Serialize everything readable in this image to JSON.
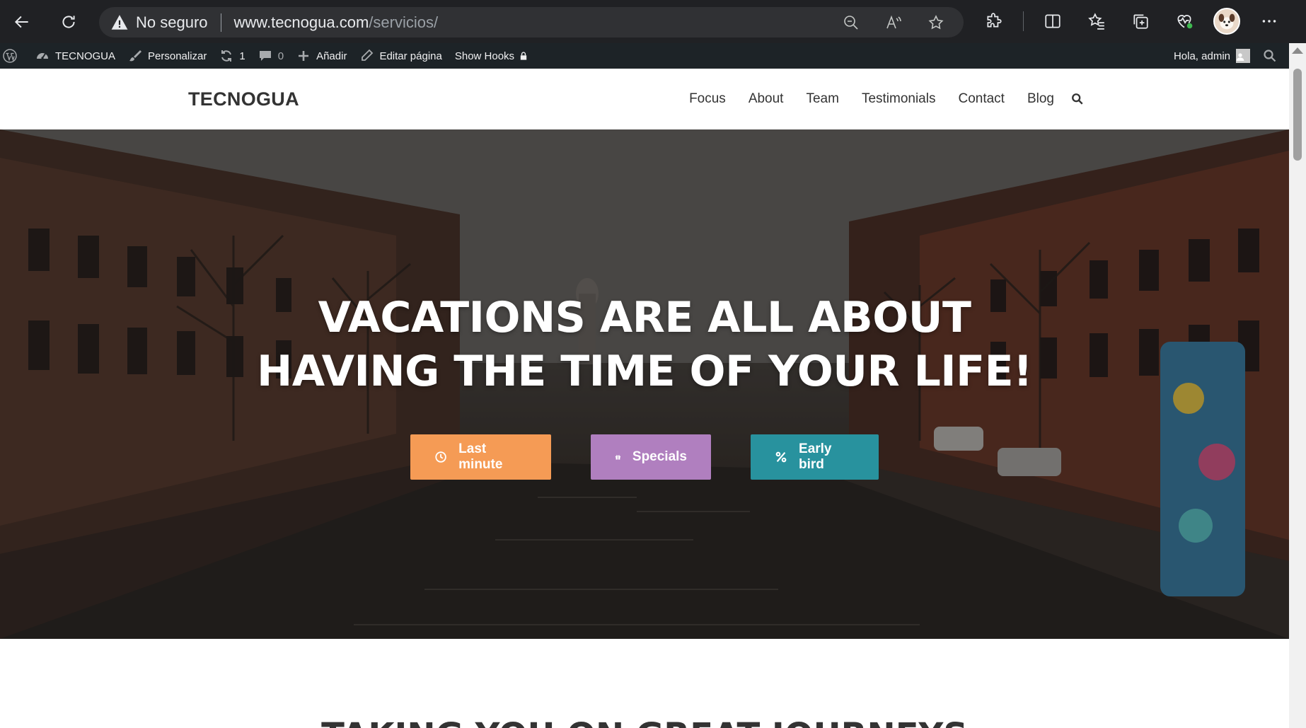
{
  "browser": {
    "security_label": "No seguro",
    "url_host": "www.tecnogua.com",
    "url_path": "/servicios/",
    "icons": [
      "back-arrow-icon",
      "refresh-icon",
      "warning-icon",
      "zoom-out-icon",
      "read-aloud-icon",
      "favorite-star-icon",
      "extensions-icon",
      "split-screen-icon",
      "favorites-icon",
      "collections-icon",
      "browser-essentials-icon",
      "profile-avatar",
      "more-menu-icon"
    ]
  },
  "admin_bar": {
    "site_name": "TECNOGUA",
    "customize": "Personalizar",
    "updates_count": "1",
    "comments_count": "0",
    "add_new": "Añadir",
    "edit_page": "Editar página",
    "show_hooks": "Show Hooks",
    "greeting": "Hola, admin"
  },
  "site": {
    "title": "TECNOGUA",
    "nav": [
      "Focus",
      "About",
      "Team",
      "Testimonials",
      "Contact",
      "Blog"
    ]
  },
  "hero": {
    "title_line1": "VACATIONS ARE ALL ABOUT",
    "title_line2": "HAVING THE TIME OF YOUR LIFE!",
    "buttons": [
      {
        "label": "Last minute",
        "color": "#f59b55",
        "icon": "clock-icon"
      },
      {
        "label": "Specials",
        "color": "#b07fbf",
        "icon": "gift-icon"
      },
      {
        "label": "Early bird",
        "color": "#28929e",
        "icon": "percent-icon"
      }
    ]
  },
  "next_section": {
    "heading_partial": "TAKING YOU ON GREAT JOURNEYS"
  },
  "colors": {
    "browser_bg": "#202124",
    "admin_bar_bg": "#1d2327",
    "accent_orange": "#f59b55",
    "accent_purple": "#b07fbf",
    "accent_teal": "#28929e"
  }
}
